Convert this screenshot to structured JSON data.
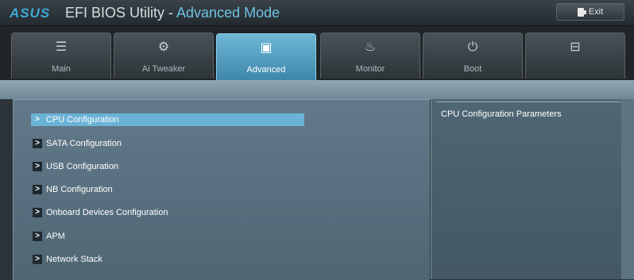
{
  "window": {
    "logo": "ASUS",
    "title_app": "EFI BIOS Utility",
    "title_sep": " - ",
    "title_mode": "Advanced Mode",
    "exit_label": "Exit"
  },
  "tabs": [
    {
      "label": "Main",
      "icon": "list-icon",
      "glyph": "☰"
    },
    {
      "label": "Ai Tweaker",
      "icon": "ai-tweaker-icon",
      "glyph": "⚙"
    },
    {
      "label": "Advanced",
      "icon": "advanced-icon",
      "glyph": "▣"
    },
    {
      "label": "Monitor",
      "icon": "monitor-icon",
      "glyph": "♨"
    },
    {
      "label": "Boot",
      "icon": "power-icon",
      "glyph": "⏻"
    },
    {
      "label": "",
      "icon": "tool-icon",
      "glyph": "⊟"
    }
  ],
  "active_tab": "Advanced",
  "menu": {
    "items": [
      {
        "label": "CPU Configuration",
        "selected": true
      },
      {
        "label": "SATA Configuration",
        "selected": false
      },
      {
        "label": "USB Configuration",
        "selected": false
      },
      {
        "label": "NB Configuration",
        "selected": false
      },
      {
        "label": "Onboard Devices Configuration",
        "selected": false
      },
      {
        "label": "APM",
        "selected": false
      },
      {
        "label": "Network Stack",
        "selected": false
      }
    ],
    "arrow": ">"
  },
  "help": {
    "text": "CPU Configuration Parameters"
  },
  "colors": {
    "accent": "#6bb3d6",
    "title_mode": "#6fc2e3",
    "logo": "#3fa6d6"
  }
}
